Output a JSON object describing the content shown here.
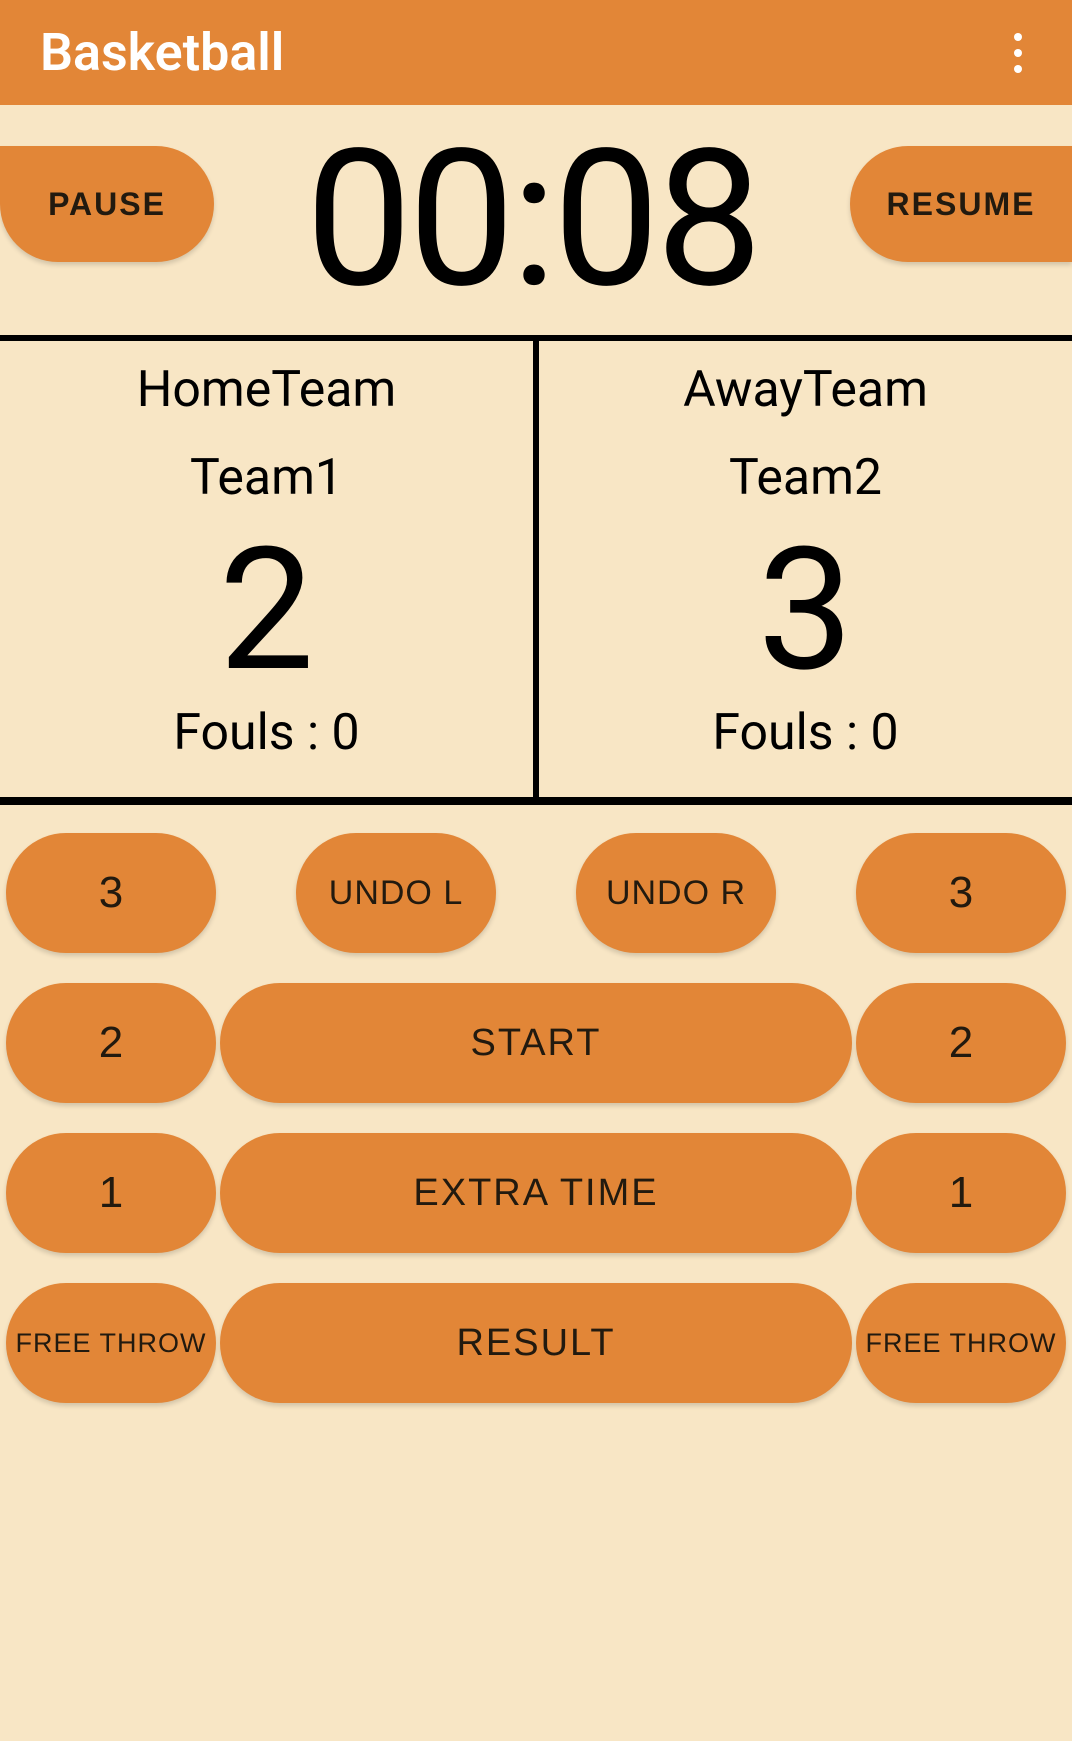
{
  "header": {
    "title": "Basketball"
  },
  "timer": {
    "pause_label": "PAUSE",
    "resume_label": "RESUME",
    "display": "00:08"
  },
  "home": {
    "label": "HomeTeam",
    "name": "Team1",
    "score": "2",
    "fouls": "Fouls  :  0"
  },
  "away": {
    "label": "AwayTeam",
    "name": "Team2",
    "score": "3",
    "fouls": "Fouls  :  0"
  },
  "controls": {
    "three_l": "3",
    "undo_l": "UNDO L",
    "undo_r": "UNDO R",
    "three_r": "3",
    "two_l": "2",
    "start": "START",
    "two_r": "2",
    "one_l": "1",
    "extra_time": "EXTRA TIME",
    "one_r": "1",
    "ft_l": "FREE THROW",
    "result": "RESULT",
    "ft_r": "FREE THROW"
  }
}
